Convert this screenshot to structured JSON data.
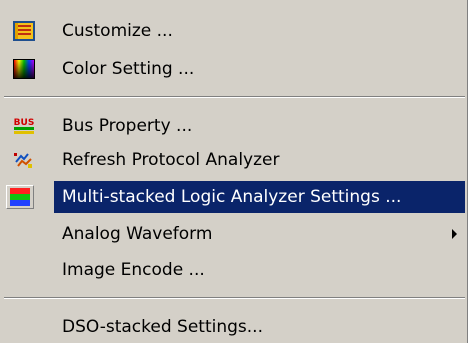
{
  "menu": {
    "items": [
      {
        "label": "Customize ...",
        "icon": "customize-icon"
      },
      {
        "label": "Color Setting ...",
        "icon": "color-setting-icon"
      },
      {
        "label": "Bus Property ...",
        "icon": "bus-property-icon",
        "icon_text": "BUS"
      },
      {
        "label": "Refresh Protocol Analyzer",
        "icon": "refresh-protocol-icon"
      },
      {
        "label": "Multi-stacked Logic Analyzer Settings ...",
        "icon": "multi-stacked-icon",
        "highlighted": true
      },
      {
        "label": "Analog Waveform",
        "has_submenu": true
      },
      {
        "label": "Image Encode ..."
      },
      {
        "label": "DSO-stacked Settings..."
      }
    ],
    "colors": {
      "background": "#d4d0c8",
      "highlight": "#0a246a",
      "highlight_text": "#ffffff"
    }
  }
}
